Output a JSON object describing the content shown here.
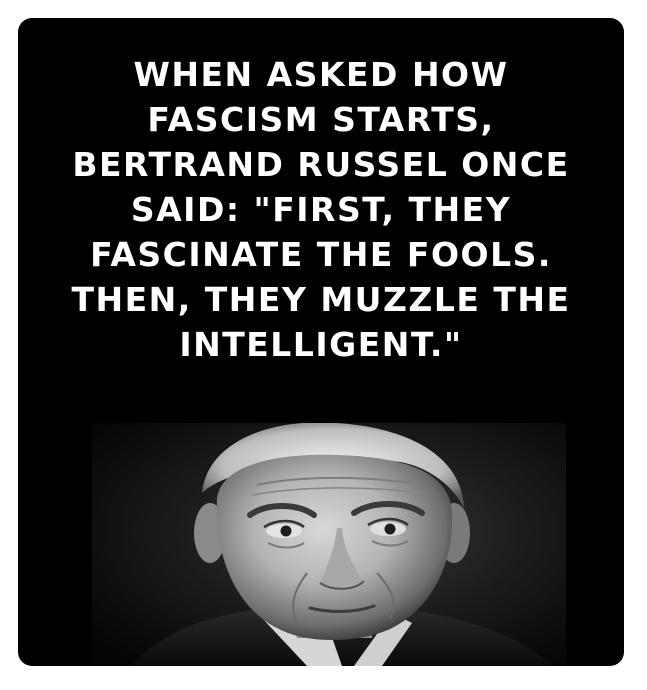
{
  "quote": {
    "lines": [
      "WHEN ASKED HOW",
      "FASCISM STARTS,",
      "BERTRAND RUSSEL ONCE",
      "SAID: \"FIRST, THEY",
      "FASCINATE THE FOOLS.",
      "THEN, THEY MUZZLE THE",
      "INTELLIGENT.\""
    ]
  },
  "portrait": {
    "icon": "portrait-photo",
    "style": "black-and-white"
  },
  "colors": {
    "background": "#000000",
    "text": "#ffffff",
    "page": "#ffffff"
  }
}
